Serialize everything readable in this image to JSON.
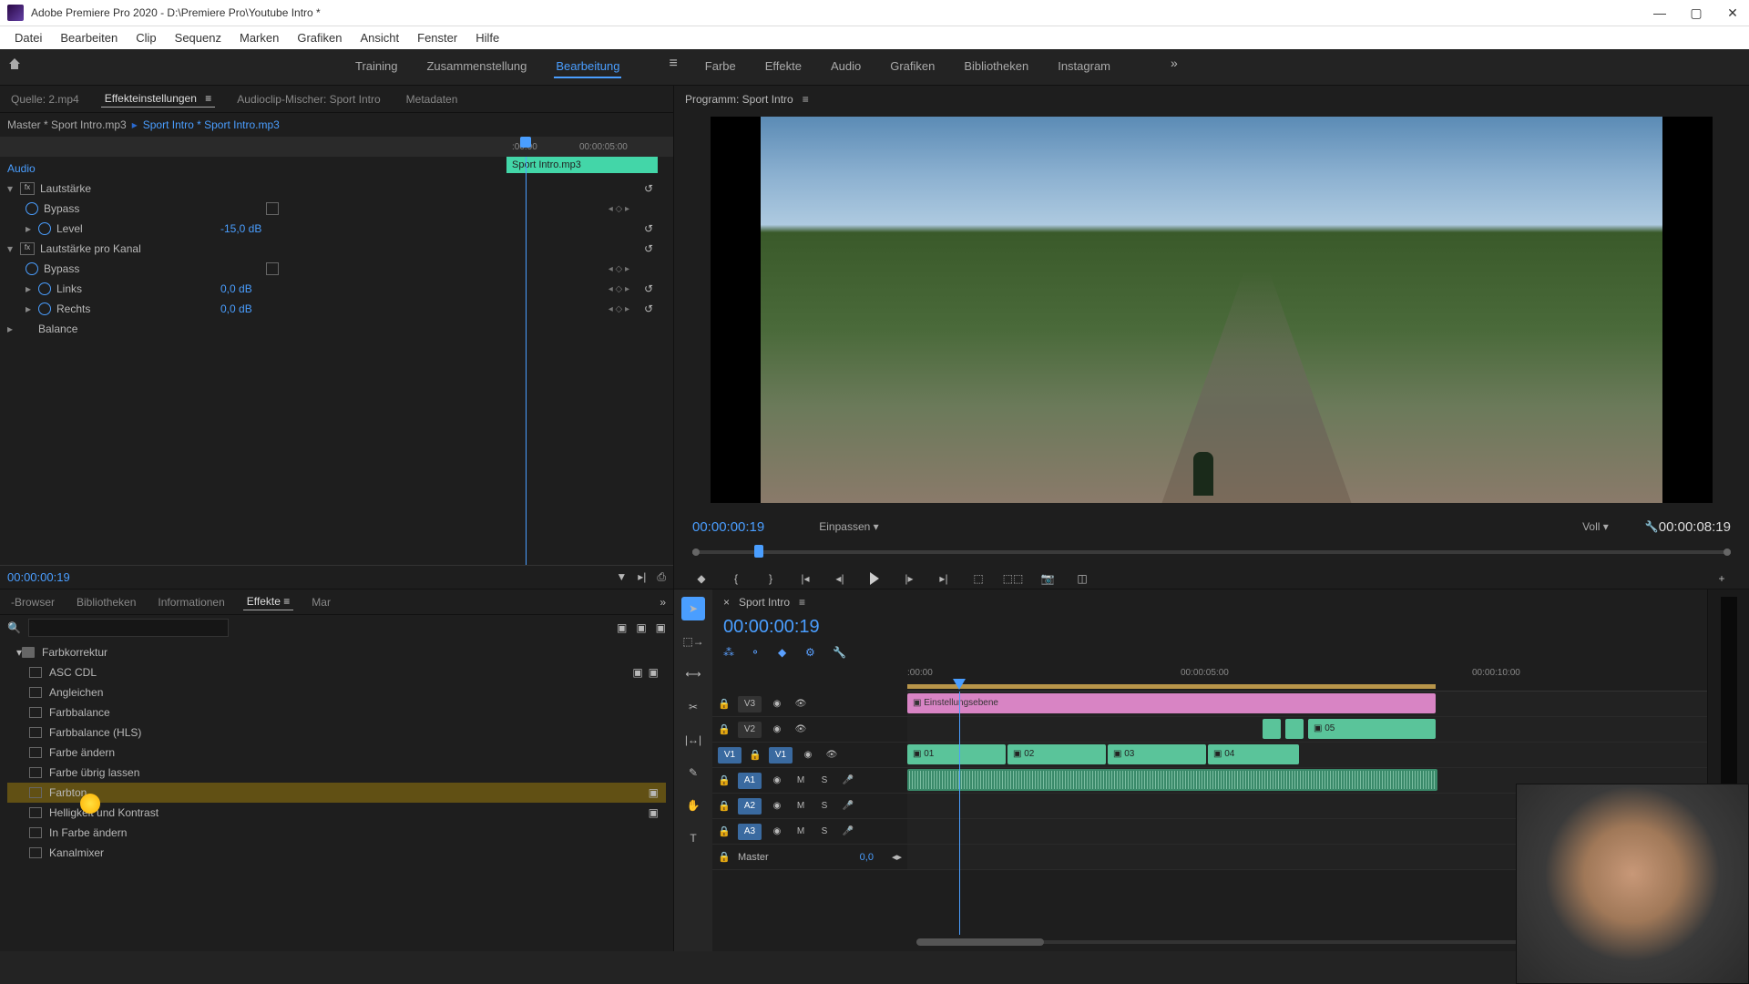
{
  "app": {
    "title": "Adobe Premiere Pro 2020 - D:\\Premiere Pro\\Youtube Intro *"
  },
  "menubar": [
    "Datei",
    "Bearbeiten",
    "Clip",
    "Sequenz",
    "Marken",
    "Grafiken",
    "Ansicht",
    "Fenster",
    "Hilfe"
  ],
  "workspaces": {
    "tabs": [
      "Training",
      "Zusammenstellung",
      "Bearbeitung",
      "Farbe",
      "Effekte",
      "Audio",
      "Grafiken",
      "Bibliotheken",
      "Instagram"
    ],
    "active": "Bearbeitung"
  },
  "source_tabs": {
    "items": [
      "Quelle: 2.mp4",
      "Effekteinstellungen",
      "Audioclip-Mischer: Sport Intro",
      "Metadaten"
    ],
    "active": "Effekteinstellungen"
  },
  "effect_controls": {
    "master": "Master * Sport Intro.mp3",
    "clip": "Sport Intro * Sport Intro.mp3",
    "timeline_ticks": [
      ":00:00",
      "00:00:05:00"
    ],
    "clip_bar": "Sport Intro.mp3",
    "sections": {
      "audio": "Audio",
      "lautstarke": "Lautstärke",
      "bypass1": "Bypass",
      "level": "Level",
      "level_val": "-15,0 dB",
      "lautstarke_kanal": "Lautstärke pro Kanal",
      "bypass2": "Bypass",
      "links": "Links",
      "links_val": "0,0 dB",
      "rechts": "Rechts",
      "rechts_val": "0,0 dB",
      "balance": "Balance"
    },
    "footer_time": "00:00:00:19"
  },
  "program": {
    "title": "Programm: Sport Intro",
    "time_left": "00:00:00:19",
    "fit": "Einpassen",
    "quality": "Voll",
    "time_right": "00:00:08:19"
  },
  "effects_panel": {
    "tabs": [
      "-Browser",
      "Bibliotheken",
      "Informationen",
      "Effekte",
      "Mar"
    ],
    "active": "Effekte",
    "search_placeholder": "",
    "category": "Farbkorrektur",
    "items": [
      "ASC CDL",
      "Angleichen",
      "Farbbalance",
      "Farbbalance (HLS)",
      "Farbe ändern",
      "Farbe übrig lassen",
      "Farbton",
      "Helligkeit und Kontrast",
      "In Farbe ändern",
      "Kanalmixer"
    ]
  },
  "timeline": {
    "seq_name": "Sport Intro",
    "time": "00:00:00:19",
    "ruler": [
      ":00:00",
      "00:00:05:00",
      "00:00:10:00"
    ],
    "tracks": {
      "v3": "V3",
      "v2": "V2",
      "v1": "V1",
      "a1": "A1",
      "a2": "A2",
      "a3": "A3",
      "master": "Master",
      "master_val": "0,0"
    },
    "clips": {
      "adj": "Einstellungsebene",
      "c1": "01",
      "c2": "02",
      "c3": "03",
      "c4": "04",
      "c5": "05"
    }
  }
}
